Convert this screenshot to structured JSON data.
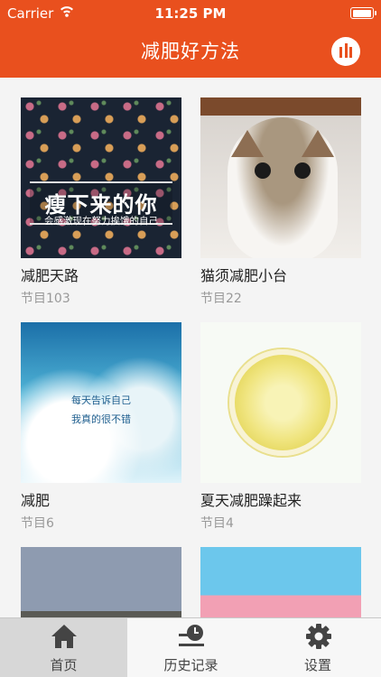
{
  "status": {
    "carrier": "Carrier",
    "time": "11:25 PM"
  },
  "nav": {
    "title": "减肥好方法",
    "chart_button": "bar-chart-icon"
  },
  "thumb1_text": {
    "big": "瘦下来的你",
    "small": "会感激现在努力挨饿的自己"
  },
  "thumb3_text": {
    "line1": "每天告诉自己",
    "line2": "我真的很不错"
  },
  "cards": [
    {
      "title": "减肥天路",
      "subtitle": "节目103"
    },
    {
      "title": "猫须减肥小台",
      "subtitle": "节目22"
    },
    {
      "title": "减肥",
      "subtitle": "节目6"
    },
    {
      "title": "夏天减肥躁起来",
      "subtitle": "节目4"
    }
  ],
  "tabs": [
    {
      "label": "首页",
      "icon": "home-icon",
      "active": true
    },
    {
      "label": "历史记录",
      "icon": "history-icon",
      "active": false
    },
    {
      "label": "设置",
      "icon": "gear-icon",
      "active": false
    }
  ],
  "colors": {
    "accent": "#e9501e",
    "tabbar": "#f7f7f7",
    "active_tab": "#d7d7d7"
  }
}
